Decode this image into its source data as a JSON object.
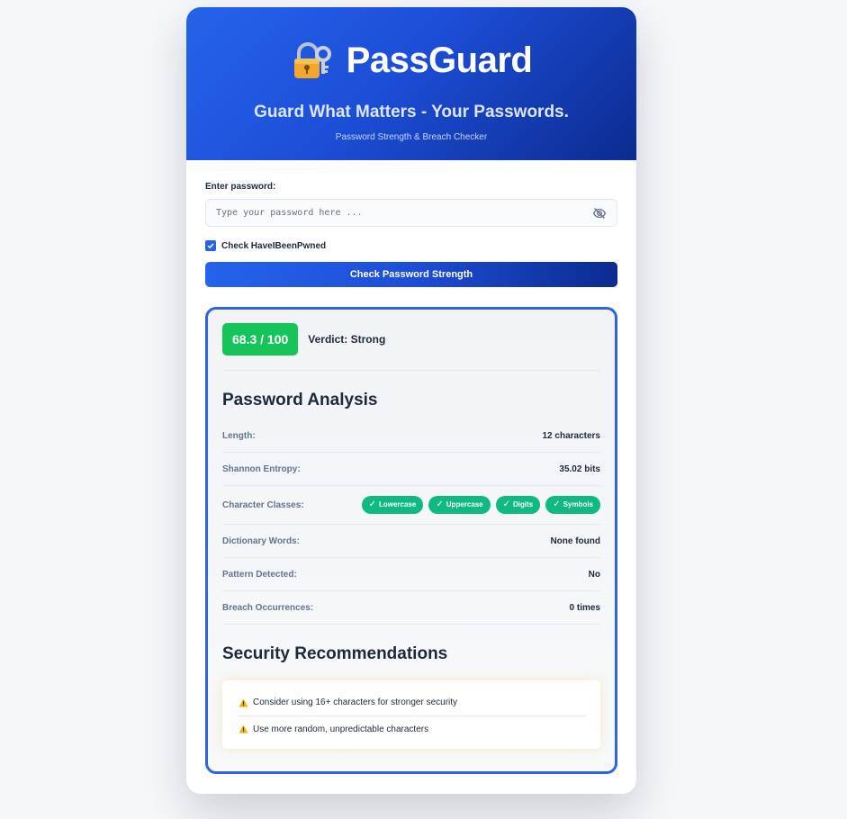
{
  "header": {
    "brand": "PassGuard",
    "logo_icon": "lock-with-key-icon",
    "tagline": "Guard What Matters - Your Passwords.",
    "subtagline": "Password Strength & Breach Checker"
  },
  "form": {
    "password_label": "Enter password:",
    "password_placeholder": "Type your password here ...",
    "password_value": "",
    "visibility_icon": "eye-off-icon",
    "hibp_label": "Check HaveIBeenPwned",
    "hibp_checked": true,
    "submit_label": "Check Password Strength"
  },
  "result": {
    "score": "68.3 / 100",
    "score_color": "#16c55a",
    "verdict": "Verdict: Strong",
    "analysis_title": "Password Analysis",
    "rows": [
      {
        "label": "Length:",
        "value": "12 characters"
      },
      {
        "label": "Shannon Entropy:",
        "value": "35.02 bits"
      },
      {
        "label": "Character Classes:",
        "value": ""
      },
      {
        "label": "Dictionary Words:",
        "value": "None found"
      },
      {
        "label": "Pattern Detected:",
        "value": "No"
      },
      {
        "label": "Breach Occurrences:",
        "value": "0 times"
      }
    ],
    "classes": [
      "Lowercase",
      "Uppercase",
      "Digits",
      "Symbols"
    ],
    "class_check": "✓",
    "recommendations_title": "Security Recommendations",
    "recommendations": [
      "Consider using 16+ characters for stronger security",
      "Use more random, unpredictable characters"
    ]
  },
  "colors": {
    "primary": "#2563eb",
    "primary_dark": "#0b2b8f",
    "success": "#16c55a",
    "chip": "#10b981"
  }
}
